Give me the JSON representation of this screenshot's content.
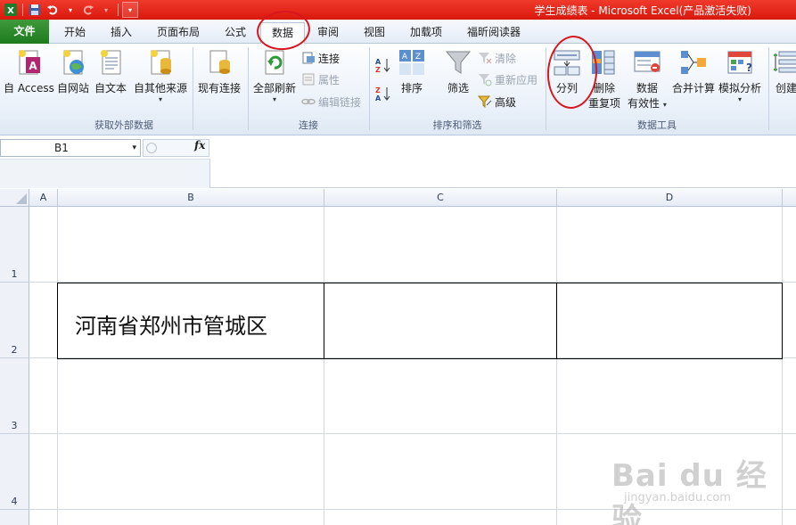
{
  "window": {
    "title": "学生成绩表 - Microsoft Excel(产品激活失败)"
  },
  "tabs": {
    "file": "文件",
    "items": [
      "开始",
      "插入",
      "页面布局",
      "公式",
      "数据",
      "审阅",
      "视图",
      "加载项",
      "福昕阅读器"
    ],
    "active": "数据"
  },
  "ribbon": {
    "external": {
      "label": "获取外部数据",
      "access": "自 Access",
      "web": "自网站",
      "text": "自文本",
      "other": "自其他来源",
      "existing": "现有连接"
    },
    "connections": {
      "label": "连接",
      "refresh_all": "全部刷新",
      "connections": "连接",
      "properties": "属性",
      "edit_links": "编辑链接"
    },
    "sort_filter": {
      "label": "排序和筛选",
      "sort": "排序",
      "filter": "筛选",
      "clear": "清除",
      "reapply": "重新应用",
      "advanced": "高级"
    },
    "data_tools": {
      "label": "数据工具",
      "text_to_columns": "分列",
      "remove_dup_1": "删除",
      "remove_dup_2": "重复项",
      "validation_1": "数据",
      "validation_2": "有效性",
      "consolidate": "合并计算",
      "what_if": "模拟分析"
    },
    "outline": {
      "create": "创建"
    }
  },
  "formula_bar": {
    "name_box": "B1",
    "fx": "fx",
    "value": ""
  },
  "grid": {
    "columns": [
      "A",
      "B",
      "C",
      "D"
    ],
    "rows": [
      "1",
      "2",
      "3",
      "4"
    ],
    "cell_B2": "河南省郑州市管城区"
  },
  "watermark": {
    "brand": "Bai du 经验",
    "url": "jingyan.baidu.com"
  },
  "colors": {
    "title_bar": "#e0251a",
    "file_tab": "#2a8a2a",
    "annotation": "#d8161e"
  }
}
